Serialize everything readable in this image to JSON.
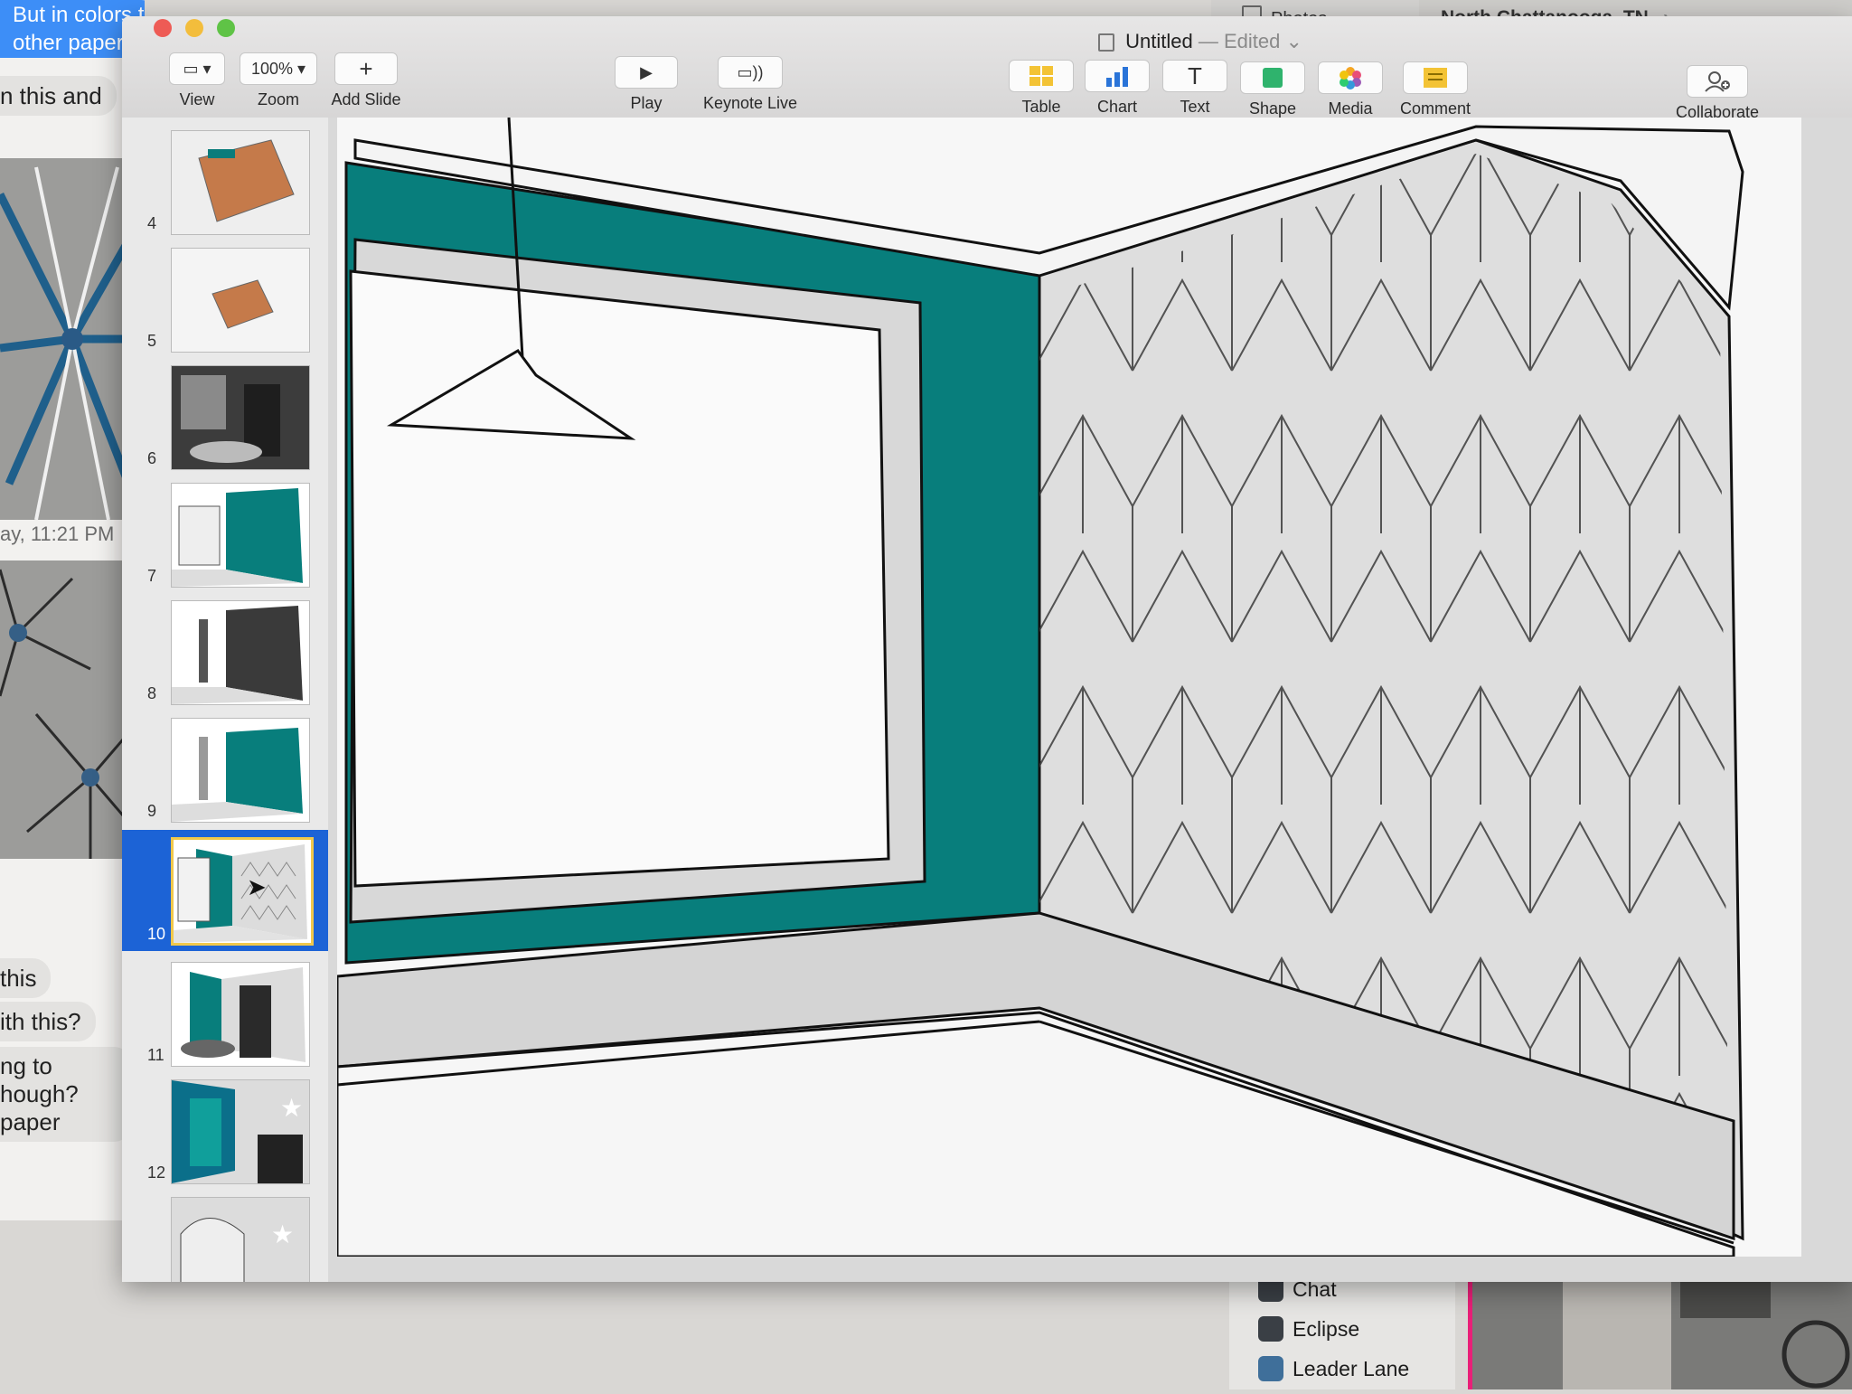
{
  "messages_app": {
    "bubble_1": "But in colors t",
    "bubble_2": "other paper a",
    "gray_1": "n this and",
    "timestamp": "ay, 11:21 PM",
    "gray_2": "this",
    "gray_3": "ith this?",
    "gray_4_line1": "ng to",
    "gray_4_line2": "hough?",
    "gray_4_line3": "paper"
  },
  "photos_app": {
    "title": "Photos"
  },
  "maps_app": {
    "location": "North Chattanooga, TN"
  },
  "dock_list": [
    {
      "label": "Chat"
    },
    {
      "label": "Eclipse"
    },
    {
      "label": "Leader Lane"
    }
  ],
  "keynote": {
    "title": "Untitled",
    "status": "Edited",
    "toolbar_left": [
      {
        "label": "View",
        "button": "▭ ▾"
      },
      {
        "label": "Zoom",
        "button": "100% ▾"
      },
      {
        "label": "Add Slide",
        "button": "+"
      }
    ],
    "toolbar_center": [
      {
        "label": "Play",
        "button": "▶"
      },
      {
        "label": "Keynote Live",
        "button": "▭))"
      }
    ],
    "toolbar_right": [
      {
        "label": "Table"
      },
      {
        "label": "Chart"
      },
      {
        "label": "Text"
      },
      {
        "label": "Shape"
      },
      {
        "label": "Media"
      },
      {
        "label": "Comment"
      }
    ],
    "collaborate": "Collaborate",
    "slides": [
      {
        "number": "4"
      },
      {
        "number": "5"
      },
      {
        "number": "6"
      },
      {
        "number": "7"
      },
      {
        "number": "8"
      },
      {
        "number": "9"
      },
      {
        "number": "10",
        "selected": true
      },
      {
        "number": "11"
      },
      {
        "number": "12"
      }
    ],
    "colors": {
      "accent_wall": "#087e7c",
      "selection": "#1c63d6",
      "wallpaper": "#dedede"
    }
  }
}
